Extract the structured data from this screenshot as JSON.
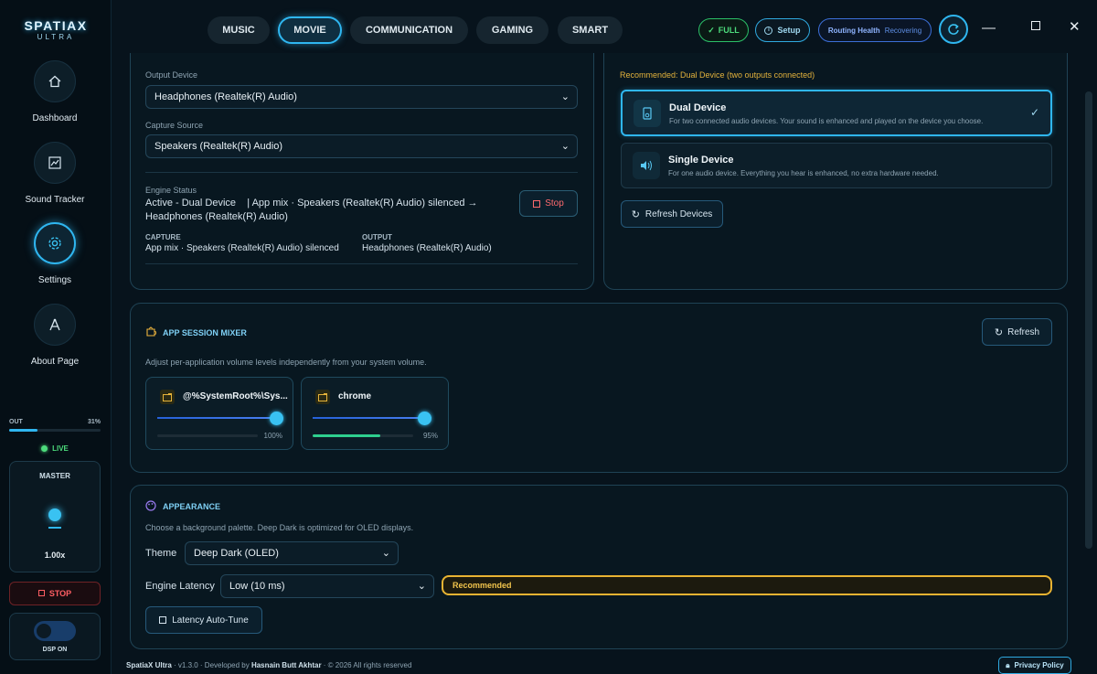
{
  "app": {
    "logo_line1": "SPATIAX",
    "logo_line2": "ULTRA"
  },
  "sidebar": {
    "items": [
      {
        "label": "Dashboard",
        "icon": "home-icon"
      },
      {
        "label": "Sound Tracker",
        "icon": "chart-icon"
      },
      {
        "label": "Settings",
        "icon": "gear-icon",
        "active": true
      },
      {
        "label": "About Page",
        "icon": "info-icon"
      }
    ],
    "out_label": "OUT",
    "out_value": "31%",
    "out_level": 0.31,
    "live_label": "LIVE",
    "master_label": "MASTER",
    "master_value": "1.00x",
    "stop_label": "STOP",
    "dsp_label": "DSP ON"
  },
  "tabs": [
    "MUSIC",
    "MOVIE",
    "COMMUNICATION",
    "GAMING",
    "SMART"
  ],
  "active_tab": "MOVIE",
  "header": {
    "full_label": "FULL",
    "setup_label": "Setup",
    "health_label": "Routing Health",
    "health_status": "Recovering"
  },
  "output": {
    "output_device_label": "Output Device",
    "output_device_value": "Headphones (Realtek(R) Audio)",
    "capture_source_label": "Capture Source",
    "capture_source_value": "Speakers (Realtek(R) Audio)",
    "engine_status_label": "Engine Status",
    "engine_status_line1": "Active - Dual Device    | App mix · Speakers (Realtek(R) Audio) silenced →",
    "engine_status_line2": "Headphones (Realtek(R) Audio)",
    "stop_label": "Stop",
    "capture_label": "CAPTURE",
    "capture_value": "App mix · Speakers (Realtek(R) Audio) silenced",
    "output_label": "OUTPUT",
    "output_value": "Headphones (Realtek(R) Audio)"
  },
  "devices": {
    "recommended_text": "Recommended: Dual Device (two outputs connected)",
    "dual_name": "Dual Device",
    "dual_desc": "For two connected audio devices. Your sound is enhanced and played on the device you choose.",
    "single_name": "Single Device",
    "single_desc": "For one audio device. Everything you hear is enhanced, no extra hardware needed.",
    "refresh_label": "Refresh Devices"
  },
  "mixer": {
    "title": "APP SESSION MIXER",
    "description": "Adjust per-application volume levels independently from your system volume.",
    "refresh_label": "Refresh",
    "apps": [
      {
        "name": "@%SystemRoot%\\Sys...",
        "volume": 1.0,
        "level": 0.0,
        "percent": "100%"
      },
      {
        "name": "chrome",
        "volume": 1.0,
        "level": 0.6,
        "percent": "95%"
      }
    ]
  },
  "appearance": {
    "title": "APPEARANCE",
    "description": "Choose a background palette. Deep Dark is optimized for OLED displays.",
    "theme_label": "Theme",
    "theme_value": "Deep Dark (OLED)",
    "latency_label": "Engine Latency",
    "latency_value": "Low (10 ms)",
    "latency_badge": "Recommended",
    "autotune_label": "Latency Auto-Tune"
  },
  "footer": {
    "app_name": "SpatiaX Ultra",
    "text": " · v1.3.0 · Developed by ",
    "author": "Hasnain Butt Akhtar",
    "copyright": " · © 2026 All rights reserved",
    "privacy_label": "Privacy Policy"
  },
  "colors": {
    "accent": "#2fb6f0",
    "success": "#4ddc7c",
    "danger": "#ff5e63",
    "warning": "#e8b332"
  }
}
